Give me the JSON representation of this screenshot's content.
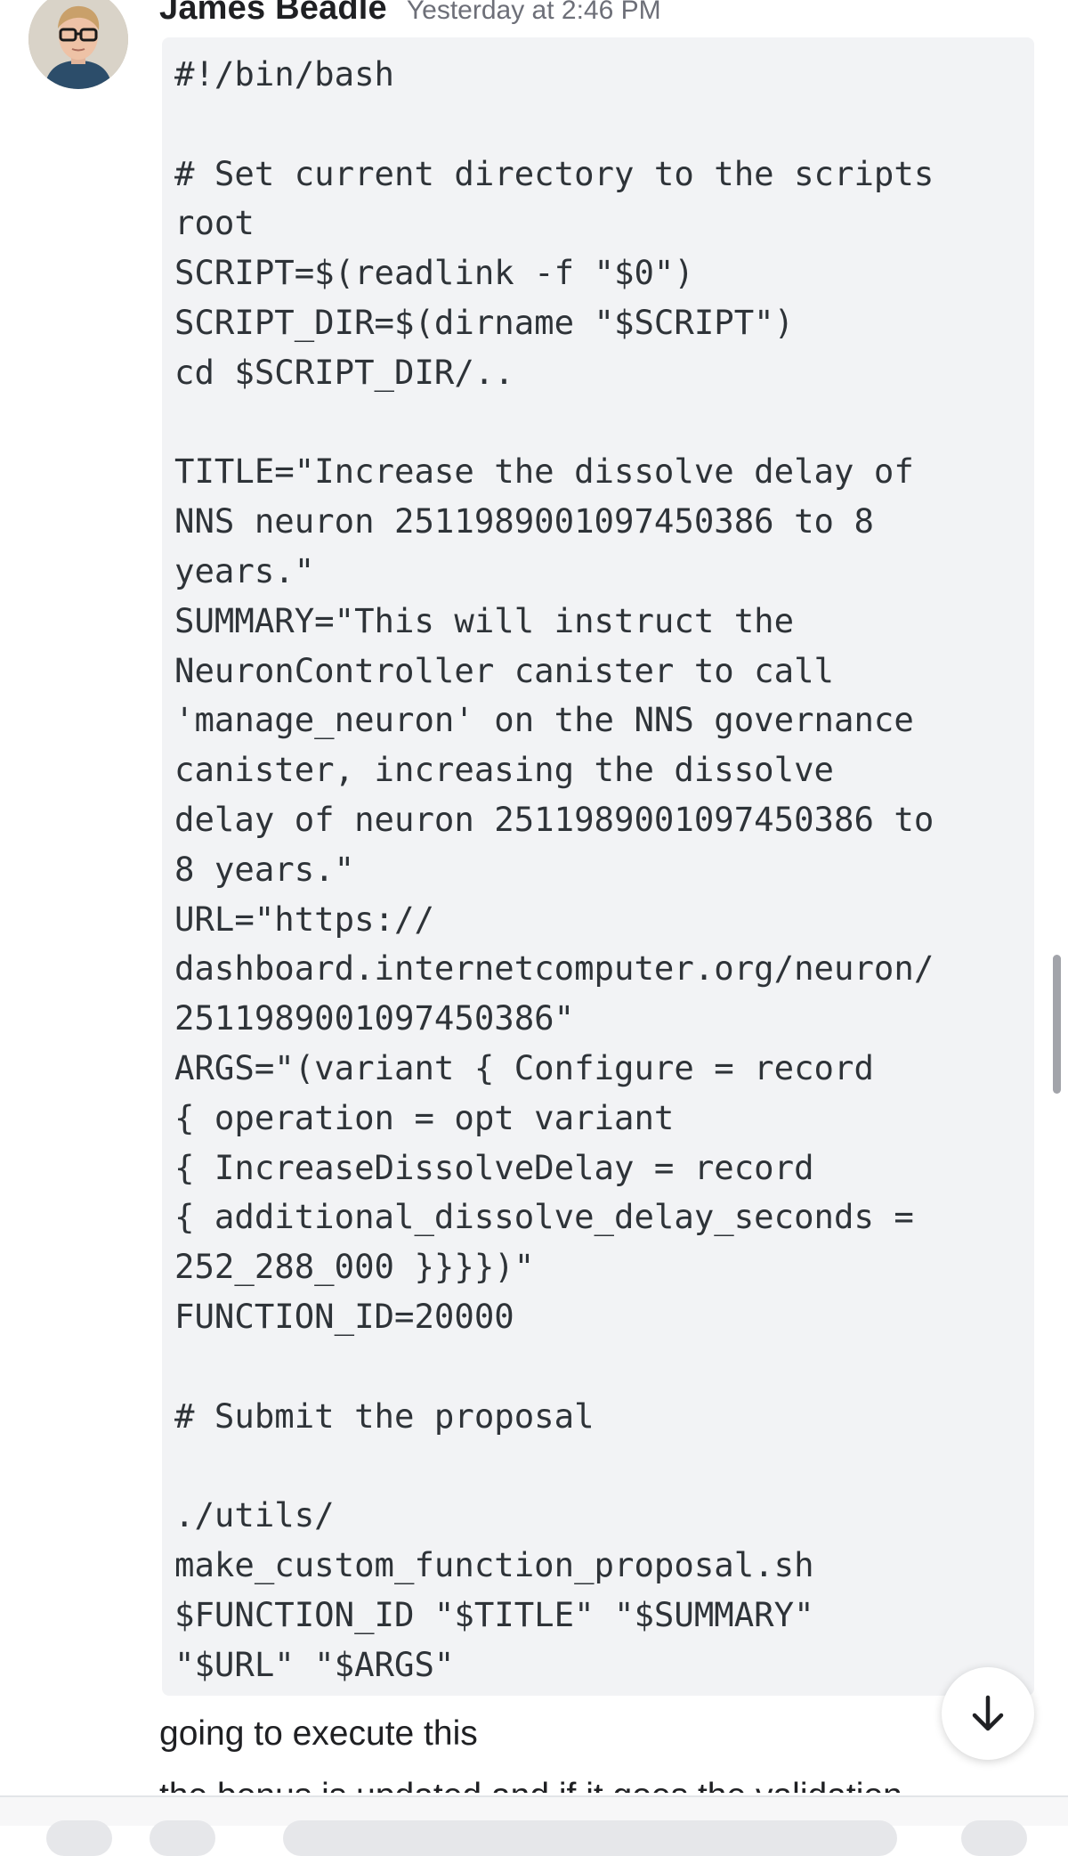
{
  "message": {
    "author": "James Beadle",
    "timestamp": "Yesterday at 2:46 PM",
    "avatar_icon": "user-avatar-photo",
    "code": "#!/bin/bash\n\n# Set current directory to the scripts\nroot\nSCRIPT=$(readlink -f \"$0\")\nSCRIPT_DIR=$(dirname \"$SCRIPT\")\ncd $SCRIPT_DIR/..\n\nTITLE=\"Increase the dissolve delay of\nNNS neuron 2511989001097450386 to 8\nyears.\"\nSUMMARY=\"This will instruct the\nNeuronController canister to call\n'manage_neuron' on the NNS governance\ncanister, increasing the dissolve\ndelay of neuron 2511989001097450386 to\n8 years.\"\nURL=\"https://\ndashboard.internetcomputer.org/neuron/\n2511989001097450386\"\nARGS=\"(variant { Configure = record\n{ operation = opt variant\n{ IncreaseDissolveDelay = record\n{ additional_dissolve_delay_seconds =\n252_288_000 }}}})\"\nFUNCTION_ID=20000\n\n# Submit the proposal\n\n./utils/\nmake_custom_function_proposal.sh\n$FUNCTION_ID \"$TITLE\" \"$SUMMARY\"\n\"$URL\" \"$ARGS\""
  },
  "follow_up": {
    "text": "going to execute this",
    "partial_next_line": "the bonus is updated and if it goes the validation"
  },
  "controls": {
    "jump_icon": "arrow-down-icon"
  },
  "colors": {
    "code_background": "#f2f3f5",
    "timestamp": "#6d6f78",
    "text": "#1f2023"
  }
}
